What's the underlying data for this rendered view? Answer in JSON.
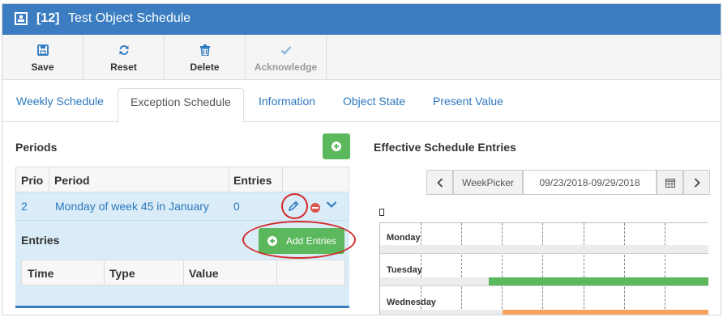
{
  "window": {
    "id_label": "[12]",
    "title": "Test Object Schedule",
    "title_icon": "object-icon",
    "accent_color": "#3b7dc0"
  },
  "toolbar": {
    "buttons": [
      {
        "label": "Save",
        "icon": "save-icon",
        "enabled": true
      },
      {
        "label": "Reset",
        "icon": "refresh-icon",
        "enabled": true
      },
      {
        "label": "Delete",
        "icon": "trash-icon",
        "enabled": true
      },
      {
        "label": "Acknowledge",
        "icon": "check-icon",
        "enabled": false
      }
    ]
  },
  "tabs": [
    {
      "label": "Weekly Schedule",
      "active": false
    },
    {
      "label": "Exception Schedule",
      "active": true
    },
    {
      "label": "Information",
      "active": false
    },
    {
      "label": "Object State",
      "active": false
    },
    {
      "label": "Present Value",
      "active": false
    }
  ],
  "periods": {
    "title": "Periods",
    "columns": [
      "Prio",
      "Period",
      "Entries"
    ],
    "rows": [
      {
        "prio": "2",
        "period": "Monday of week 45 in January",
        "entries": "0"
      }
    ],
    "entries_panel": {
      "title": "Entries",
      "add_label": "Add Entries",
      "columns": [
        "Time",
        "Type",
        "Value"
      ]
    }
  },
  "effective": {
    "title": "Effective Schedule Entries",
    "week_picker_label": "WeekPicker",
    "week_range": "09/23/2018-09/29/2018",
    "days": [
      "Monday",
      "Tuesday",
      "Wednesday"
    ],
    "colors": {
      "on": "#5cb85c",
      "other": "#f7a35c",
      "track": "#ececec"
    }
  }
}
